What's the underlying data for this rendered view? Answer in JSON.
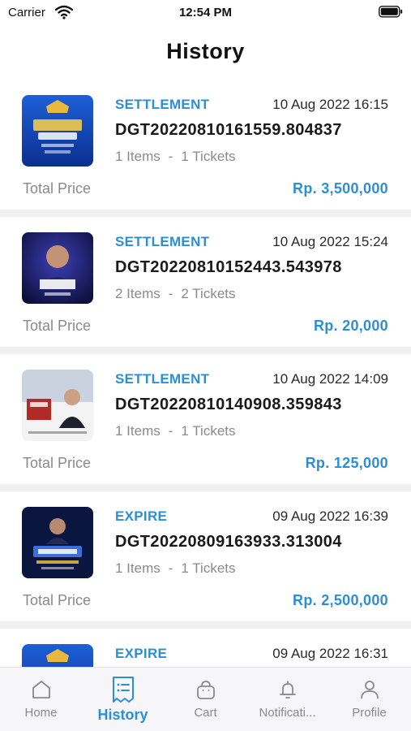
{
  "status_bar": {
    "carrier": "Carrier",
    "time": "12:54 PM"
  },
  "header": {
    "title": "History"
  },
  "orders": [
    {
      "status": "SETTLEMENT",
      "date": "10 Aug 2022 16:15",
      "order_id": "DGT20220810161559.804837",
      "items": "1 Items",
      "separator": "-",
      "tickets": "1 Tickets",
      "total_label": "Total Price",
      "price": "Rp. 3,500,000",
      "thumb": "event-poster-amazing-you"
    },
    {
      "status": "SETTLEMENT",
      "date": "10 Aug 2022 15:24",
      "order_id": "DGT20220810152443.543978",
      "items": "2 Items",
      "separator": "-",
      "tickets": "2 Tickets",
      "total_label": "Total Price",
      "price": "Rp. 20,000",
      "thumb": "event-poster-inner-power"
    },
    {
      "status": "SETTLEMENT",
      "date": "10 Aug 2022 14:09",
      "order_id": "DGT20220810140908.359843",
      "items": "1 Items",
      "separator": "-",
      "tickets": "1 Tickets",
      "total_label": "Total Price",
      "price": "Rp. 125,000",
      "thumb": "event-poster-book"
    },
    {
      "status": "EXPIRE",
      "date": "09 Aug 2022 16:39",
      "order_id": "DGT20220809163933.313004",
      "items": "1 Items",
      "separator": "-",
      "tickets": "1 Tickets",
      "total_label": "Total Price",
      "price": "Rp. 2,500,000",
      "thumb": "event-poster-executive"
    },
    {
      "status": "EXPIRE",
      "date": "09 Aug 2022 16:31",
      "order_id": "",
      "items": "",
      "separator": "",
      "tickets": "",
      "total_label": "",
      "price": "",
      "thumb": "event-poster-amazing-you"
    }
  ],
  "tab_bar": {
    "tabs": [
      {
        "label": "Home",
        "icon": "home-icon"
      },
      {
        "label": "History",
        "icon": "receipt-icon",
        "active": true
      },
      {
        "label": "Cart",
        "icon": "bag-icon"
      },
      {
        "label": "Notificati...",
        "icon": "bell-icon"
      },
      {
        "label": "Profile",
        "icon": "person-icon"
      }
    ]
  },
  "colors": {
    "accent": "#2b8fd6",
    "muted": "#8a8a8a",
    "separator": "#f0f0f2"
  }
}
